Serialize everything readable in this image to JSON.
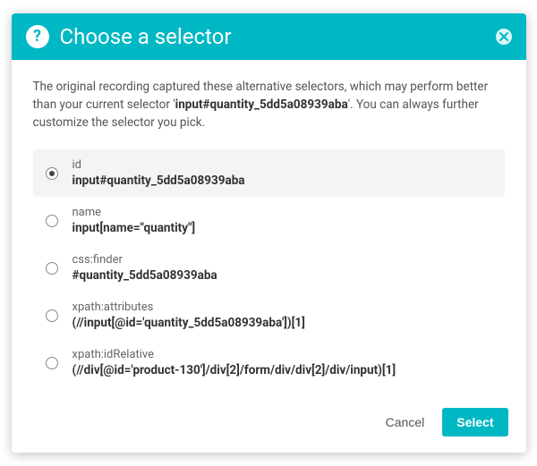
{
  "header": {
    "title": "Choose a selector"
  },
  "description": {
    "pre": "The original recording captured these alternative selectors, which may perform better than your current selector '",
    "current_selector": "input#quantity_5dd5a08939aba",
    "post": "'. You can always further customize the selector you pick."
  },
  "options": [
    {
      "label": "id",
      "value": "input#quantity_5dd5a08939aba",
      "selected": true
    },
    {
      "label": "name",
      "value": "input[name=\"quantity\"]",
      "selected": false
    },
    {
      "label": "css:finder",
      "value": "#quantity_5dd5a08939aba",
      "selected": false
    },
    {
      "label": "xpath:attributes",
      "value": "(//input[@id='quantity_5dd5a08939aba'])[1]",
      "selected": false
    },
    {
      "label": "xpath:idRelative",
      "value": "(//div[@id='product-130']/div[2]/form/div/div[2]/div/input)[1]",
      "selected": false
    }
  ],
  "footer": {
    "cancel_label": "Cancel",
    "select_label": "Select"
  }
}
